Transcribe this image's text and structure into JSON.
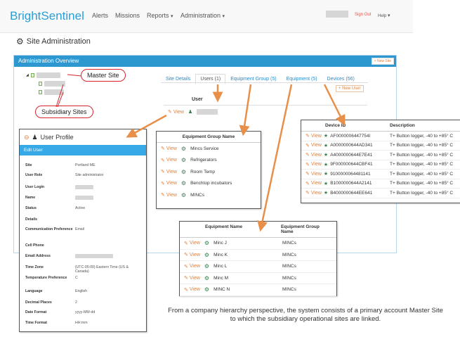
{
  "navbar": {
    "brand_light": "Bright",
    "brand_bold": "Sentinel",
    "items": [
      "Alerts",
      "Missions",
      "Reports",
      "Administration"
    ],
    "sign_out": "Sign Out",
    "help": "Help"
  },
  "page_title": "Site Administration",
  "admin": {
    "header": "Administration Overview",
    "new_site": "New Site"
  },
  "callouts": {
    "master": "Master Site",
    "subsidiary": "Subsidiary Sites"
  },
  "tabs": [
    "Site Details",
    "Users (1)",
    "Equipment Group (5)",
    "Equipment (5)",
    "Devices (56)"
  ],
  "new_user": "New User",
  "user_table": {
    "header": "User",
    "view": "View"
  },
  "equipment_group_card": {
    "header": "Equipment Group Name",
    "view": "View",
    "rows": [
      "Mincs Service",
      "Refrigerators",
      "Room Temp",
      "Benchtop incubators",
      "MINCs"
    ]
  },
  "device_card": {
    "headers": [
      "Device ID",
      "Description"
    ],
    "view": "View",
    "rows": [
      [
        "AF0000006447754l",
        "T+ Button logger, -40 to +85° C"
      ],
      [
        "A0000000644AD341",
        "T+ Button logger, -40 to +85° C"
      ],
      [
        "A4000000644E7E41",
        "T+ Button logger, -40 to +85° C"
      ],
      [
        "9F000000644CBF41",
        "T+ Button logger, -40 to +85° C"
      ],
      [
        "9100000064481141",
        "T+ Button logger, -40 to +85° C"
      ],
      [
        "B1000000644A2141",
        "T+ Button logger, -40 to +85° C"
      ],
      [
        "B4000000644EE641",
        "T+ Button logger, -40 to +85° C"
      ]
    ]
  },
  "equipment_card": {
    "headers": [
      "Equipment Name",
      "Equipment Group Name"
    ],
    "view": "View",
    "rows": [
      [
        "Minc J",
        "MINCs"
      ],
      [
        "Minc K",
        "MINCs"
      ],
      [
        "Minc L",
        "MINCs"
      ],
      [
        "Minc M",
        "MINCs"
      ],
      [
        "MINC N",
        "MINCs"
      ]
    ]
  },
  "profile": {
    "title": "User Profile",
    "edit": "Edit User",
    "fields": [
      [
        "Site",
        "Portland ME"
      ],
      [
        "User Role",
        "Site administrator"
      ],
      [
        "User Login",
        ""
      ],
      [
        "Name",
        ""
      ],
      [
        "Status",
        "Active"
      ],
      [
        "Details",
        ""
      ],
      [
        "Communication Preference",
        "Email"
      ],
      [
        "Cell Phone",
        ""
      ],
      [
        "Email Address",
        ""
      ],
      [
        "Time Zone",
        "(UTC-05:00) Eastern Time (US & Canada)"
      ],
      [
        "Temperature Preference",
        "C"
      ],
      [
        "Language",
        "English"
      ],
      [
        "Decimal Places",
        "2"
      ],
      [
        "Date Format",
        "yyyy-MM-dd"
      ],
      [
        "Time Format",
        "HH:mm"
      ]
    ]
  },
  "caption": "From a company hierarchy perspective, the system consists of a primary account Master Site to which the subsidiary operational sites are linked.",
  "colors": {
    "accent": "#2a9fd6",
    "orange": "#e0803d",
    "callout_border": "#d9232d"
  }
}
